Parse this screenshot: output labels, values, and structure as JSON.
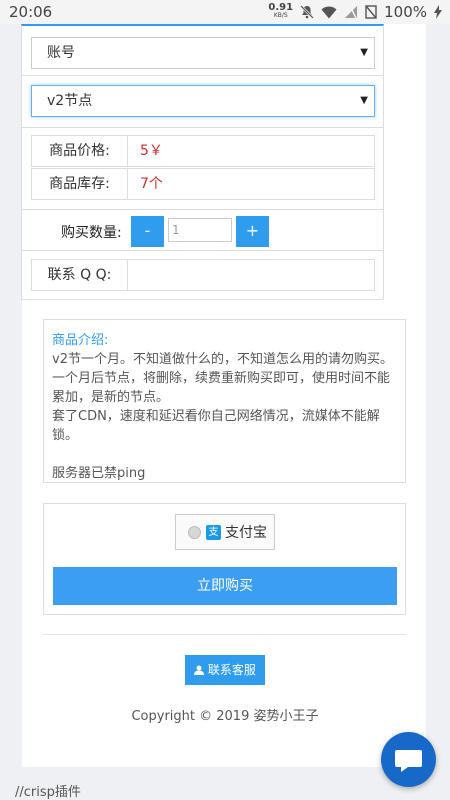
{
  "status_bar": {
    "time": "20:06",
    "net_speed": "0.91",
    "net_unit": "KB/S",
    "battery": "100%"
  },
  "form": {
    "account_select": "账号",
    "product_select": "v2节点",
    "price_label": "商品价格:",
    "price_value": "5￥",
    "stock_label": "商品库存:",
    "stock_value": "7个",
    "quantity_label": "购买数量:",
    "minus": "-",
    "quantity_value": "1",
    "plus": "+",
    "qq_label": "联系 Q Q:"
  },
  "description": {
    "title": "商品介绍:",
    "lines": [
      "v2节一个月。不知道做什么的，不知道怎么用的请勿购买。",
      "一个月后节点，将删除，续费重新购买即可，使用时间不能累加，是新的节点。",
      "套了CDN，速度和延迟看你自己网络情况，流媒体不能解锁。",
      "",
      "服务器已禁ping"
    ]
  },
  "payment": {
    "method": "支付宝",
    "logo_char": "支",
    "buy_label": "立即购买"
  },
  "footer": {
    "contact_label": "联系客服",
    "copyright": "Copyright © 2019 姿势小王子",
    "crisp_note": "//crisp插件"
  },
  "colors": {
    "primary": "#2f9ced",
    "price_red": "#c9302c",
    "chat_bubble": "#1669c9"
  }
}
